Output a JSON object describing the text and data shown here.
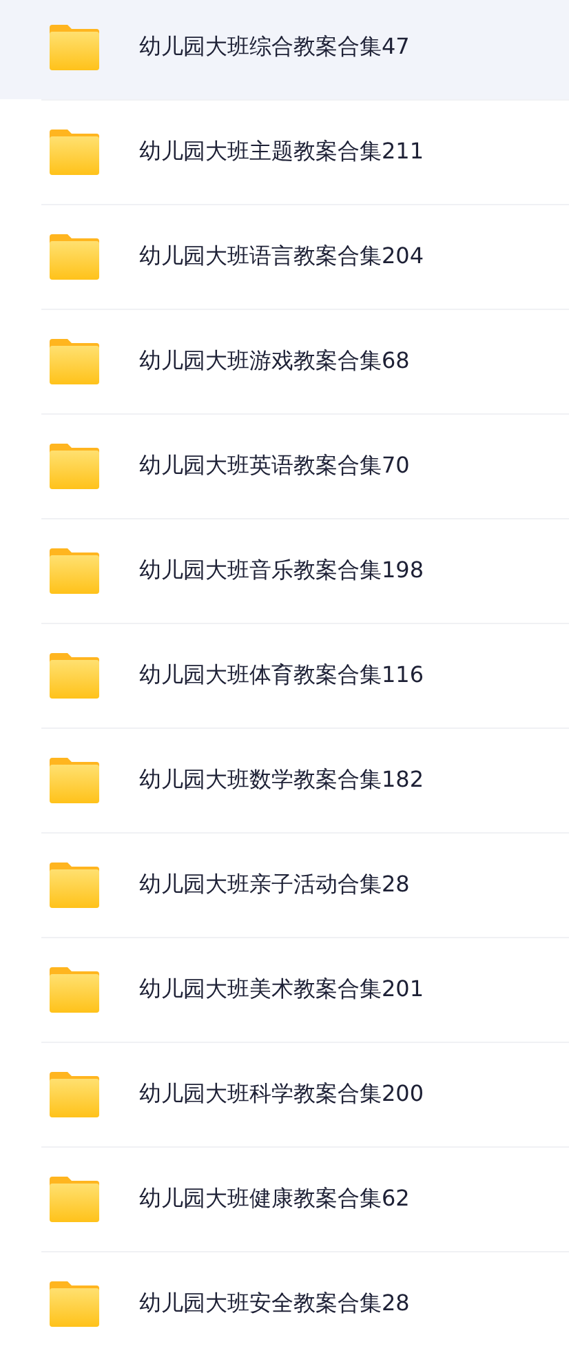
{
  "folders": [
    {
      "name": "幼儿园大班综合教案合集47",
      "selected": true
    },
    {
      "name": "幼儿园大班主题教案合集211",
      "selected": false
    },
    {
      "name": "幼儿园大班语言教案合集204",
      "selected": false
    },
    {
      "name": "幼儿园大班游戏教案合集68",
      "selected": false
    },
    {
      "name": "幼儿园大班英语教案合集70",
      "selected": false
    },
    {
      "name": "幼儿园大班音乐教案合集198",
      "selected": false
    },
    {
      "name": "幼儿园大班体育教案合集116",
      "selected": false
    },
    {
      "name": "幼儿园大班数学教案合集182",
      "selected": false
    },
    {
      "name": "幼儿园大班亲子活动合集28",
      "selected": false
    },
    {
      "name": "幼儿园大班美术教案合集201",
      "selected": false
    },
    {
      "name": "幼儿园大班科学教案合集200",
      "selected": false
    },
    {
      "name": "幼儿园大班健康教案合集62",
      "selected": false
    },
    {
      "name": "幼儿园大班安全教案合集28",
      "selected": false
    }
  ]
}
